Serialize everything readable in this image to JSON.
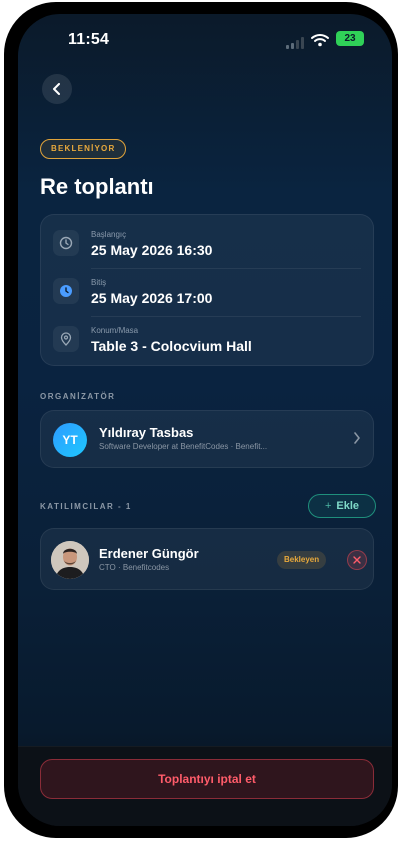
{
  "status_bar": {
    "time": "11:54",
    "battery": "23"
  },
  "meeting": {
    "status": "BEKLENİYOR",
    "title": "Re toplantı",
    "start": {
      "label": "Başlangıç",
      "value": "25 May 2026 16:30"
    },
    "end": {
      "label": "Bitiş",
      "value": "25 May 2026 17:00"
    },
    "location": {
      "label": "Konum/Masa",
      "value": "Table 3 - Colocvium Hall"
    }
  },
  "organizer": {
    "section_label": "ORGANİZATÖR",
    "initials": "YT",
    "name": "Yıldıray Tasbas",
    "subtitle": "Software Developer at BenefitCodes · Benefit..."
  },
  "participants": {
    "section_label": "KATILIMCILAR - 1",
    "add_label": "Ekle",
    "items": [
      {
        "name": "Erdener Güngör",
        "subtitle": "CTO · Benefitcodes",
        "status": "Bekleyen"
      }
    ]
  },
  "actions": {
    "cancel_label": "Toplantıyı iptal et"
  },
  "colors": {
    "accent_pending": "#e8a93c",
    "accent_teal": "#1f8f7c",
    "danger": "#ff5c6a",
    "avatar_blue": "#2e9bff"
  }
}
